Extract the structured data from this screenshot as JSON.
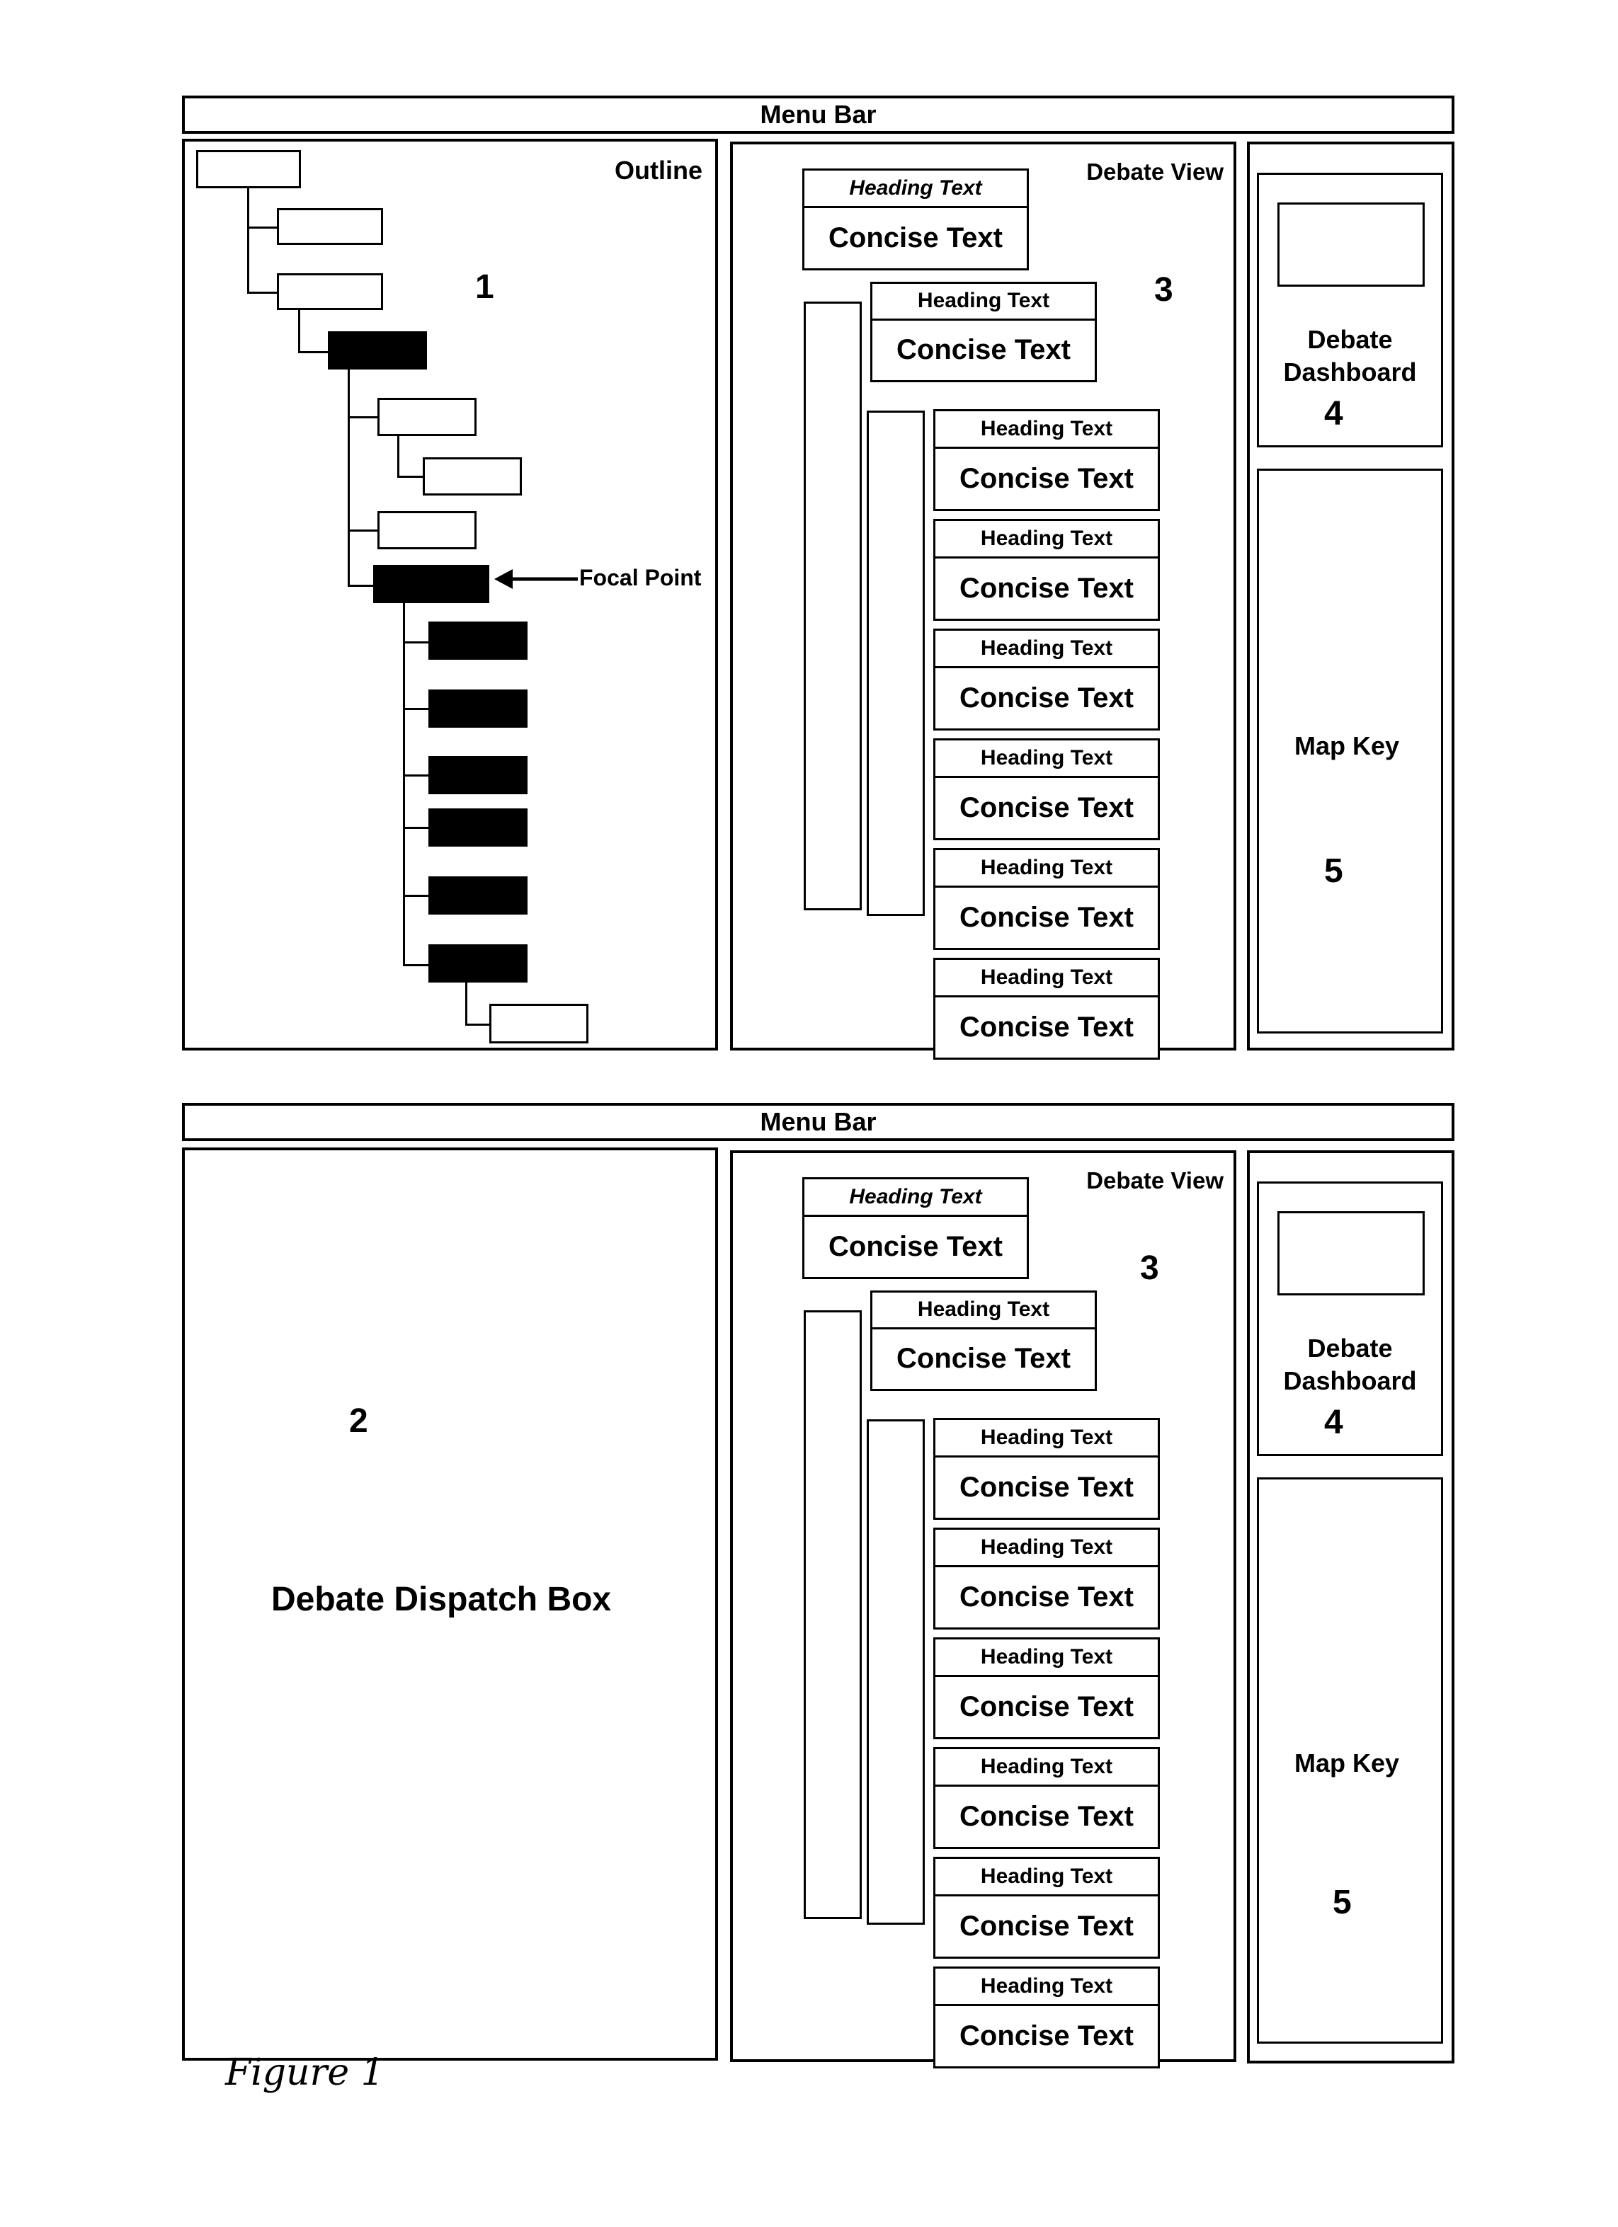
{
  "figure_caption": "Figure 1",
  "screens": [
    {
      "menu_bar": "Menu Bar",
      "left_panel": {
        "type": "outline",
        "title": "Outline",
        "ref_number": "1",
        "focal_point_label": "Focal Point",
        "nodes": [
          {
            "id": "root",
            "state": "unselected"
          },
          {
            "id": "n1",
            "state": "unselected"
          },
          {
            "id": "n2",
            "state": "unselected"
          },
          {
            "id": "n3",
            "state": "selected"
          },
          {
            "id": "n4",
            "state": "unselected"
          },
          {
            "id": "n5",
            "state": "unselected"
          },
          {
            "id": "n6",
            "state": "unselected"
          },
          {
            "id": "focal",
            "state": "selected"
          },
          {
            "id": "c1",
            "state": "selected"
          },
          {
            "id": "c2",
            "state": "selected"
          },
          {
            "id": "c3",
            "state": "selected"
          },
          {
            "id": "c4",
            "state": "selected"
          },
          {
            "id": "c5",
            "state": "selected"
          },
          {
            "id": "c6",
            "state": "selected"
          },
          {
            "id": "leaf",
            "state": "unselected"
          }
        ]
      },
      "debate_view": {
        "title": "Debate View",
        "ref_number": "3",
        "cards": [
          {
            "heading": "Heading Text",
            "concise": "Concise Text"
          },
          {
            "heading": "Heading Text",
            "concise": "Concise Text"
          },
          {
            "heading": "Heading Text",
            "concise": "Concise Text"
          },
          {
            "heading": "Heading Text",
            "concise": "Concise Text"
          },
          {
            "heading": "Heading Text",
            "concise": "Concise Text"
          },
          {
            "heading": "Heading Text",
            "concise": "Concise Text"
          },
          {
            "heading": "Heading Text",
            "concise": "Concise Text"
          },
          {
            "heading": "Heading Text",
            "concise": "Concise Text"
          }
        ]
      },
      "dashboard": {
        "title_line1": "Debate",
        "title_line2": "Dashboard",
        "ref_number": "4"
      },
      "map_key": {
        "title": "Map Key",
        "ref_number": "5"
      }
    },
    {
      "menu_bar": "Menu Bar",
      "left_panel": {
        "type": "dispatch",
        "title": "Debate Dispatch Box",
        "ref_number": "2"
      },
      "debate_view": {
        "title": "Debate View",
        "ref_number": "3",
        "cards": [
          {
            "heading": "Heading Text",
            "concise": "Concise Text"
          },
          {
            "heading": "Heading Text",
            "concise": "Concise Text"
          },
          {
            "heading": "Heading Text",
            "concise": "Concise Text"
          },
          {
            "heading": "Heading Text",
            "concise": "Concise Text"
          },
          {
            "heading": "Heading Text",
            "concise": "Concise Text"
          },
          {
            "heading": "Heading Text",
            "concise": "Concise Text"
          },
          {
            "heading": "Heading Text",
            "concise": "Concise Text"
          },
          {
            "heading": "Heading Text",
            "concise": "Concise Text"
          }
        ]
      },
      "dashboard": {
        "title_line1": "Debate",
        "title_line2": "Dashboard",
        "ref_number": "4"
      },
      "map_key": {
        "title": "Map Key",
        "ref_number": "5"
      }
    }
  ]
}
